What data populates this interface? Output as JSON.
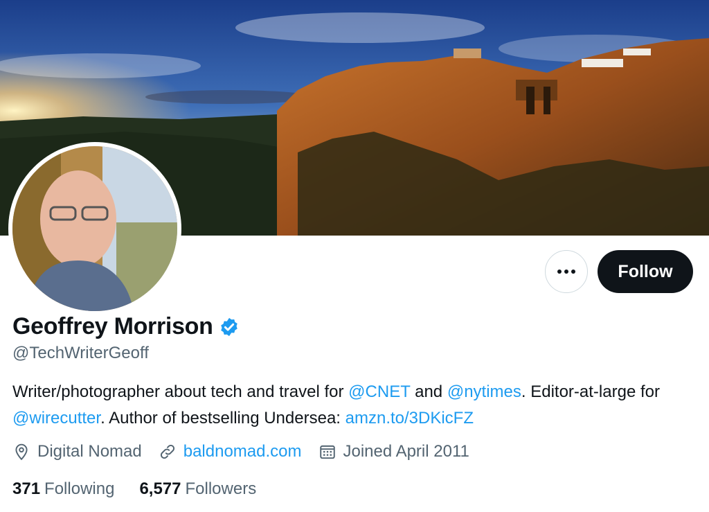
{
  "profile": {
    "name": "Geoffrey Morrison",
    "handle": "@TechWriterGeoff",
    "bio": {
      "part1": "Writer/photographer about tech and travel for ",
      "mention1": "@CNET",
      "part2": " and ",
      "mention2": "@nytimes",
      "part3": ". Editor-at-large for ",
      "mention3": "@wirecutter",
      "part4": ". Author of bestselling Undersea: ",
      "link": "amzn.to/3DKicFZ"
    },
    "location": "Digital Nomad",
    "website": "baldnomad.com",
    "joined": "Joined April 2011",
    "following_count": "371",
    "following_label": "Following",
    "followers_count": "6,577",
    "followers_label": "Followers"
  },
  "actions": {
    "follow_label": "Follow",
    "more_icon": "more-dots-icon"
  },
  "icons": [
    "location-icon",
    "link-icon",
    "calendar-icon",
    "verified-badge-icon"
  ],
  "colors": {
    "accent": "#1d9bf0",
    "text_primary": "#0f1419",
    "text_secondary": "#536471",
    "follow_button_bg": "#0f1419"
  }
}
